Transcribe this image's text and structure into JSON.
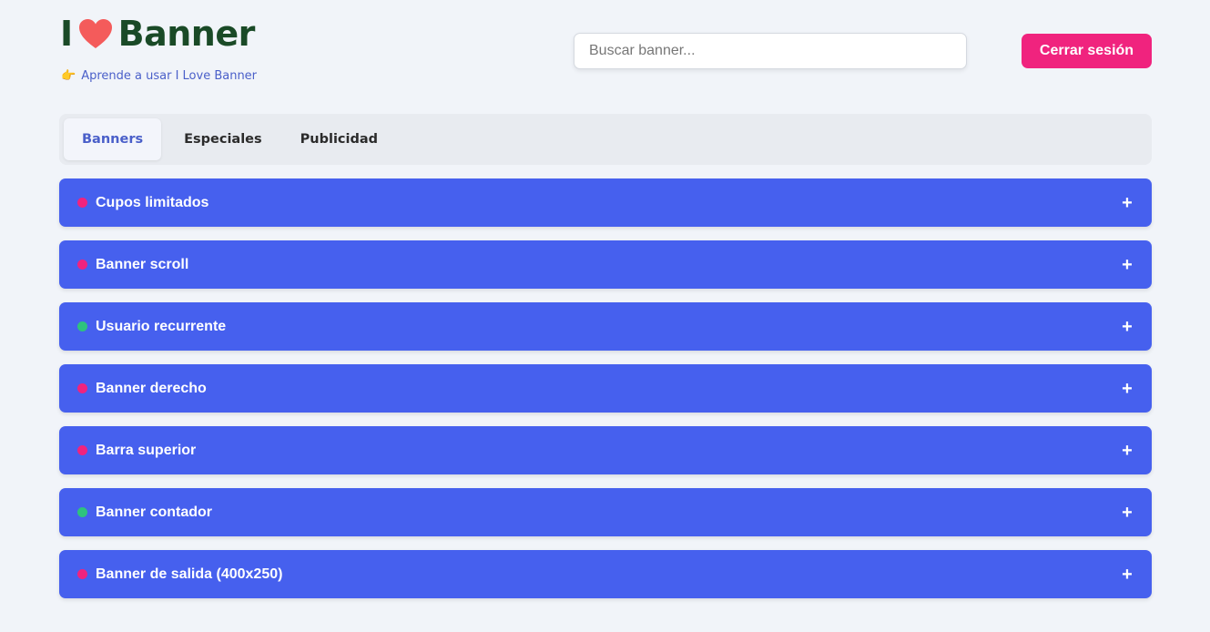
{
  "header": {
    "logo": {
      "prefix": "I",
      "suffix": "Banner",
      "heart_color": "#f45b5b"
    },
    "help_link": {
      "icon": "pointing-hand-icon",
      "label": "Aprende a usar I Love Banner"
    },
    "search": {
      "placeholder": "Buscar banner...",
      "value": ""
    },
    "logout_label": "Cerrar sesión"
  },
  "tabs": [
    {
      "label": "Banners",
      "active": true
    },
    {
      "label": "Especiales",
      "active": false
    },
    {
      "label": "Publicidad",
      "active": false
    }
  ],
  "status_colors": {
    "inactive": "#f0237e",
    "active": "#2ec27e"
  },
  "banners": [
    {
      "label": "Cupos limitados",
      "status": "inactive"
    },
    {
      "label": "Banner scroll",
      "status": "inactive"
    },
    {
      "label": "Usuario recurrente",
      "status": "active"
    },
    {
      "label": "Banner derecho",
      "status": "inactive"
    },
    {
      "label": "Barra superior",
      "status": "inactive"
    },
    {
      "label": "Banner contador",
      "status": "active"
    },
    {
      "label": "Banner de salida (400x250)",
      "status": "inactive"
    }
  ],
  "expand_symbol": "+"
}
